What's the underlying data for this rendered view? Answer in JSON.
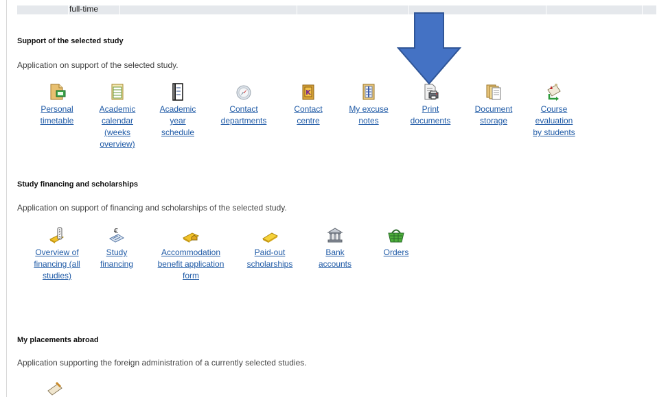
{
  "top_row": {
    "cells": [
      "",
      "full-time",
      "",
      "",
      "",
      "",
      ""
    ]
  },
  "sections": {
    "support": {
      "title": "Support of the selected study",
      "description": "Application on support of the selected study.",
      "apps": [
        {
          "label": "Personal timetable",
          "icon": "timetable-icon"
        },
        {
          "label": "Academic calendar (weeks overview)",
          "icon": "calendar-icon"
        },
        {
          "label": "Academic year schedule",
          "icon": "schedule-icon"
        },
        {
          "label": "Contact departments",
          "icon": "compass-icon"
        },
        {
          "label": "Contact centre",
          "icon": "contact-book-icon"
        },
        {
          "label": "My excuse notes",
          "icon": "notes-icon"
        },
        {
          "label": "Print documents",
          "icon": "print-icon"
        },
        {
          "label": "Document storage",
          "icon": "documents-icon"
        },
        {
          "label": "Course evaluation by students",
          "icon": "scroll-icon"
        }
      ]
    },
    "financing": {
      "title": "Study financing and scholarships",
      "description": "Application on support of financing and scholarships of the selected study.",
      "apps": [
        {
          "label": "Overview of financing (all studies)",
          "icon": "gold-bar-list-icon"
        },
        {
          "label": "Study financing",
          "icon": "euro-receipt-icon"
        },
        {
          "label": "Accommodation benefit application form",
          "icon": "gold-bar-house-icon"
        },
        {
          "label": "Paid-out scholarships",
          "icon": "gold-bar-icon"
        },
        {
          "label": "Bank accounts",
          "icon": "bank-icon"
        },
        {
          "label": "Orders",
          "icon": "basket-icon"
        }
      ]
    },
    "placements": {
      "title": "My placements abroad",
      "description": "Application supporting the foreign administration of a currently selected studies."
    }
  },
  "colors": {
    "link": "#1f5aa6",
    "arrow": "#4472c4",
    "table_bg": "#e5e8ec"
  }
}
